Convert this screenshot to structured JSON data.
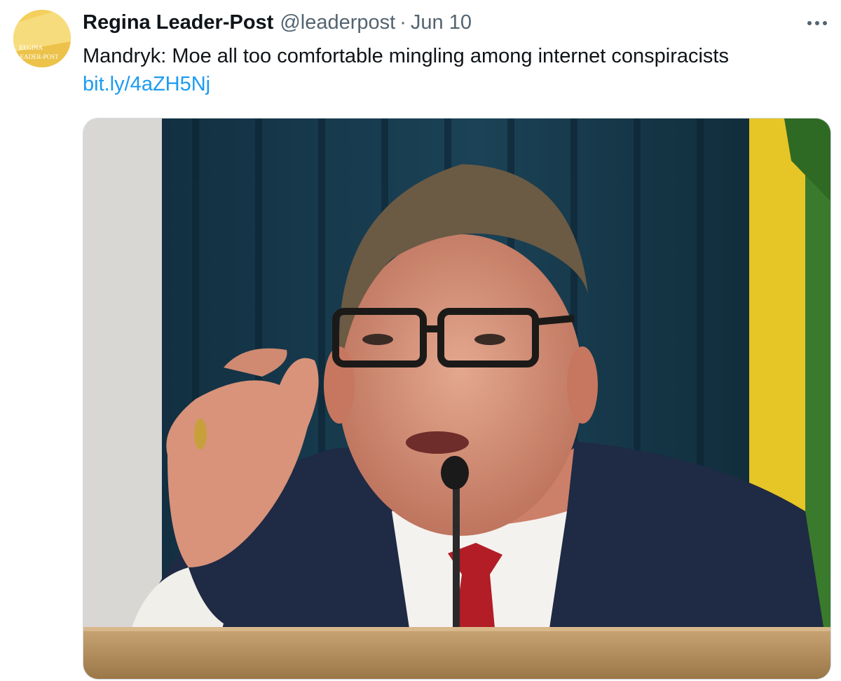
{
  "tweet": {
    "author": {
      "name": "Regina Leader-Post",
      "handle": "@leaderpost",
      "avatar_logo_text": [
        "REGINA",
        "LEADER-POST"
      ]
    },
    "separator": "·",
    "date": "Jun 10",
    "more_icon": "more-horizontal-icon",
    "text": "Mandryk: Moe all too comfortable mingling among internet conspiracists",
    "link": "bit.ly/4aZH5Nj",
    "media": {
      "subject": "man with glasses speaking at a microphone, gesturing with hand, dark curtain and green-yellow flag behind"
    }
  },
  "colors": {
    "name": "#0f1419",
    "meta": "#536471",
    "link": "#1d9bf0",
    "border": "#cfd9de",
    "avatar_bg": "#f3cf5c"
  }
}
